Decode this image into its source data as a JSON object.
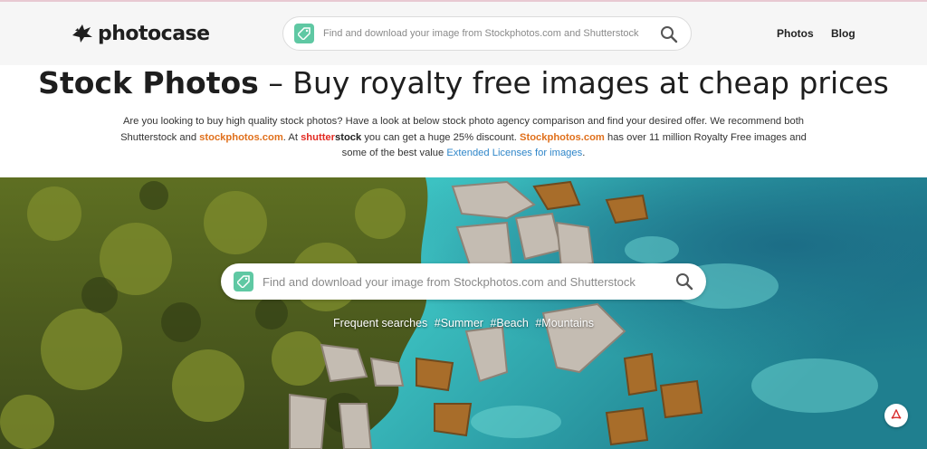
{
  "header": {
    "logo_text": "photocase",
    "search_placeholder": "Find and download your image from Stockphotos.com and Shutterstock",
    "nav": {
      "photos": "Photos",
      "blog": "Blog"
    }
  },
  "intro": {
    "title_bold": "Stock Photos",
    "title_rest": " – Buy royalty free images at cheap prices",
    "text_1": "Are you looking to buy high quality stock photos? Have a look at below stock photo agency comparison and find your desired offer. We recommend both Shutterstock and ",
    "link_stockphotos": "stockphotos.com",
    "text_2": ". At ",
    "shutter_a": "shutter",
    "shutter_b": "stock",
    "text_3": " you can get a huge 25% discount. ",
    "link_stockphotos_2": "Stockphotos.com",
    "text_4": " has over 11 million Royalty Free images and some of the best value ",
    "link_extended": "Extended Licenses for images",
    "text_5": "."
  },
  "hero": {
    "search_placeholder": "Find and download your image from Stockphotos.com and Shutterstock",
    "frequent_label": "Frequent searches",
    "tags": [
      "#Summer",
      "#Beach",
      "#Mountains"
    ]
  },
  "icons": {
    "logo": "bird-logo-icon",
    "tag": "tag-icon",
    "search": "search-icon",
    "pdf": "pdf-icon"
  },
  "colors": {
    "accent_green": "#5fc8a3",
    "orange": "#e0701c",
    "link_blue": "#2f86c9",
    "shutterstock_red": "#e22a22"
  }
}
